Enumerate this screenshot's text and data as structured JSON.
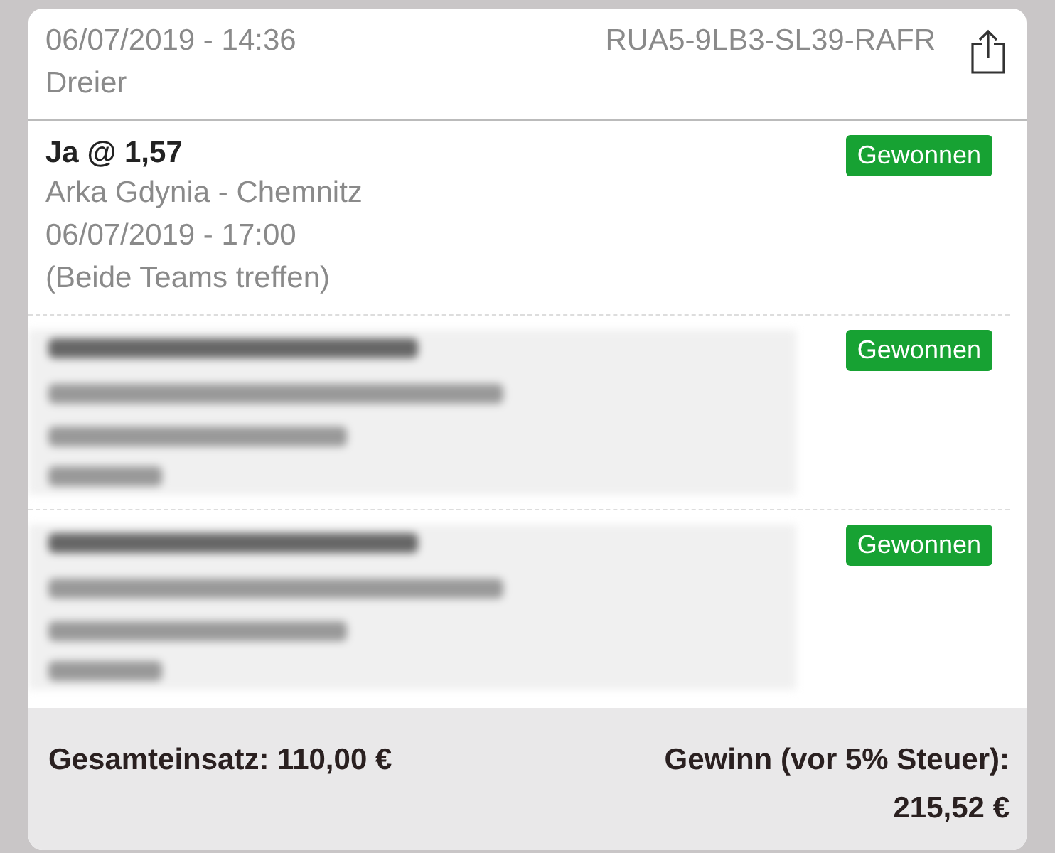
{
  "header": {
    "date": "06/07/2019 - 14:36",
    "type": "Dreier",
    "code": "RUA5-9LB3-SL39-RAFR"
  },
  "selections": [
    {
      "kind": "text",
      "pick": "Ja @ 1,57",
      "match": "Arka Gdynia - Chemnitz",
      "time": "06/07/2019 - 17:00",
      "market": "(Beide Teams treffen)",
      "status": "Gewonnen"
    },
    {
      "kind": "blurred",
      "status": "Gewonnen"
    },
    {
      "kind": "blurred",
      "status": "Gewonnen"
    }
  ],
  "footer": {
    "stake": "Gesamteinsatz: 110,00 €",
    "win_label": "Gewinn (vor 5% Steuer):",
    "win_amount": "215,52 €"
  }
}
